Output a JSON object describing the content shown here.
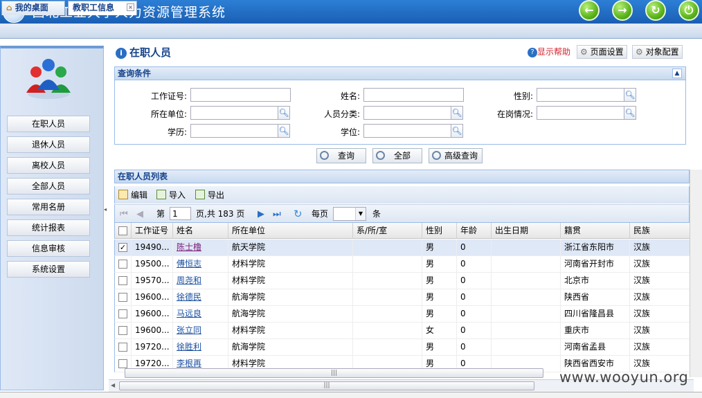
{
  "app": {
    "title": "西北工业大学人力资源管理系统",
    "header_buttons": [
      {
        "name": "back",
        "icon": "arrow-left-icon",
        "glyph": "⬅"
      },
      {
        "name": "forward",
        "icon": "arrow-right-icon",
        "glyph": "➡"
      },
      {
        "name": "refresh",
        "icon": "refresh-icon",
        "glyph": "↻"
      },
      {
        "name": "power",
        "icon": "power-icon",
        "glyph": "⏻"
      }
    ]
  },
  "tabs": [
    {
      "label": "我的桌面",
      "icon": "home-icon"
    },
    {
      "label": "教职工信息",
      "icon": "close-icon",
      "active": true
    }
  ],
  "sidebar": {
    "items": [
      {
        "label": "在职人员"
      },
      {
        "label": "退休人员"
      },
      {
        "label": "离校人员"
      },
      {
        "label": "全部人员"
      },
      {
        "label": "常用名册"
      },
      {
        "label": "统计报表"
      },
      {
        "label": "信息审核"
      },
      {
        "label": "系统设置"
      }
    ]
  },
  "panel": {
    "title": "在职人员",
    "help": "显示帮助",
    "page_settings": "页面设置",
    "object_config": "对象配置"
  },
  "query": {
    "title": "查询条件",
    "fields": {
      "staff_id": "工作证号:",
      "name": "姓名:",
      "gender": "性别:",
      "unit": "所在单位:",
      "category": "人员分类:",
      "status": "在岗情况:",
      "education": "学历:",
      "degree": "学位:"
    },
    "buttons": {
      "search": "查询",
      "all": "全部",
      "advanced": "高级查询"
    }
  },
  "list": {
    "title": "在职人员列表",
    "toolbar": {
      "edit": "编辑",
      "import": "导入",
      "export": "导出"
    },
    "pager": {
      "page_label": "第",
      "page_value": "1",
      "page_suffix": "页,共 183 页",
      "per_page": "每页",
      "per_page_unit": "条"
    },
    "columns": [
      "工作证号",
      "姓名",
      "所在单位",
      "系/所/室",
      "性别",
      "年龄",
      "出生日期",
      "籍贯",
      "民族"
    ],
    "rows": [
      {
        "checked": true,
        "id": "19490...",
        "name": "陈士橹",
        "unit": "航天学院",
        "dept": "",
        "gender": "男",
        "age": "0",
        "birth": "",
        "origin": "浙江省东阳市",
        "ethnic": "汉族"
      },
      {
        "checked": false,
        "id": "19500...",
        "name": "傅恒志",
        "unit": "材料学院",
        "dept": "",
        "gender": "男",
        "age": "0",
        "birth": "",
        "origin": "河南省开封市",
        "ethnic": "汉族"
      },
      {
        "checked": false,
        "id": "19570...",
        "name": "周尧和",
        "unit": "材料学院",
        "dept": "",
        "gender": "男",
        "age": "0",
        "birth": "",
        "origin": "北京市",
        "ethnic": "汉族"
      },
      {
        "checked": false,
        "id": "19600...",
        "name": "徐德民",
        "unit": "航海学院",
        "dept": "",
        "gender": "男",
        "age": "0",
        "birth": "",
        "origin": "陕西省",
        "ethnic": "汉族"
      },
      {
        "checked": false,
        "id": "19600...",
        "name": "马远良",
        "unit": "航海学院",
        "dept": "",
        "gender": "男",
        "age": "0",
        "birth": "",
        "origin": "四川省隆昌县",
        "ethnic": "汉族"
      },
      {
        "checked": false,
        "id": "19600...",
        "name": "张立同",
        "unit": "材料学院",
        "dept": "",
        "gender": "女",
        "age": "0",
        "birth": "",
        "origin": "重庆市",
        "ethnic": "汉族"
      },
      {
        "checked": false,
        "id": "19720...",
        "name": "徐胜利",
        "unit": "航海学院",
        "dept": "",
        "gender": "男",
        "age": "0",
        "birth": "",
        "origin": "河南省孟县",
        "ethnic": "汉族"
      },
      {
        "checked": false,
        "id": "19720...",
        "name": "李根再",
        "unit": "材料学院",
        "dept": "",
        "gender": "男",
        "age": "0",
        "birth": "",
        "origin": "陕西省西安市",
        "ethnic": "汉族"
      }
    ]
  },
  "watermark": "www.wooyun.org",
  "colors": {
    "header_blue": "#1a5fb4",
    "accent": "#15428b",
    "help_red": "#d4232d",
    "icon_green": "#5cb51c"
  }
}
